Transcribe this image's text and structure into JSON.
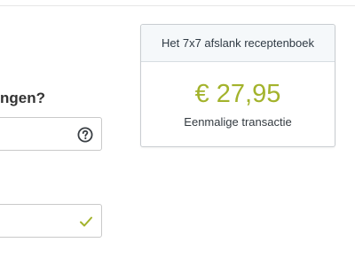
{
  "form": {
    "question_label": "ngen?",
    "field_1": {
      "value": "",
      "icon": "help-circle-icon"
    },
    "field_2": {
      "value": "",
      "icon": "check-icon"
    },
    "cut_text": "................"
  },
  "product_card": {
    "title": "Het 7x7 afslank receptenboek",
    "price": "€ 27,95",
    "price_note": "Eenmalige transactie"
  },
  "colors": {
    "accent_green": "#a3b32c",
    "border": "#c9c9c9",
    "card_header_bg": "#f5f8fa"
  }
}
